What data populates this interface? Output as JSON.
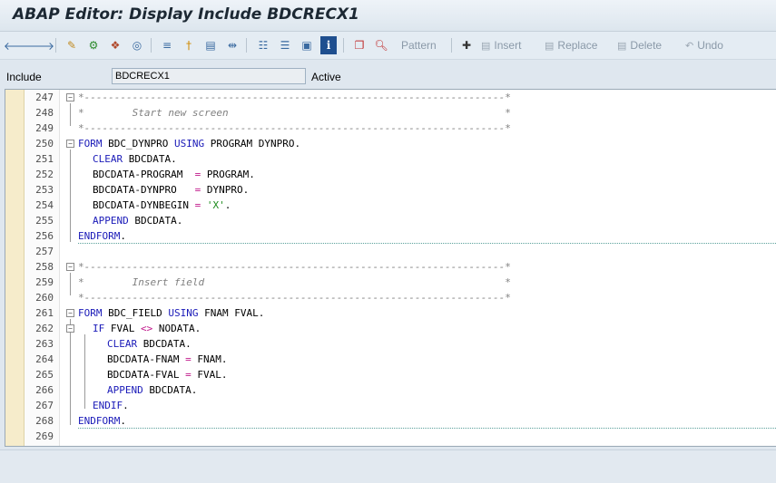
{
  "window": {
    "title": "ABAP Editor: Display Include BDCRECX1"
  },
  "toolbar": {
    "icons": [
      "back-icon",
      "forward-icon",
      "check-icon",
      "activate-icon",
      "test-icon",
      "where-used-icon",
      "display-object-list-icon",
      "breakpoint-icon",
      "navigation-window-icon",
      "pretty-printer-icon",
      "hierarchy-icon",
      "enhancement-icon",
      "screen-icon",
      "info-icon",
      "bookmark-icon",
      "search-icon"
    ],
    "pattern_label": "Pattern",
    "insert_label": "Insert",
    "replace_label": "Replace",
    "delete_label": "Delete",
    "undo_label": "Undo"
  },
  "include": {
    "label": "Include",
    "value": "BDCRECX1",
    "status": "Active"
  },
  "colors": {
    "keyword": "#1a1ab8",
    "string": "#1a8a1a",
    "operator": "#c0178b",
    "comment": "#808080",
    "gutter": "#f6eccb"
  },
  "code_lines": [
    {
      "n": "247"
    },
    {
      "n": "248"
    },
    {
      "n": "249"
    },
    {
      "n": "250"
    },
    {
      "n": "251"
    },
    {
      "n": "252"
    },
    {
      "n": "253"
    },
    {
      "n": "254"
    },
    {
      "n": "255"
    },
    {
      "n": "256"
    },
    {
      "n": "257"
    },
    {
      "n": "258"
    },
    {
      "n": "259"
    },
    {
      "n": "260"
    },
    {
      "n": "261"
    },
    {
      "n": "262"
    },
    {
      "n": "263"
    },
    {
      "n": "264"
    },
    {
      "n": "265"
    },
    {
      "n": "266"
    },
    {
      "n": "267"
    },
    {
      "n": "268"
    },
    {
      "n": "269"
    }
  ],
  "code": {
    "c247": "*----------------------------------------------------------------------*",
    "c248": "*        Start new screen                                              *",
    "c249": "*----------------------------------------------------------------------*",
    "c250_kw1": "FORM",
    "c250_a": " BDC_DYNPRO ",
    "c250_kw2": "USING",
    "c250_b": " PROGRAM DYNPRO.",
    "c251_kw": "CLEAR",
    "c251_a": " BDCDATA.",
    "c252_a": "BDCDATA-PROGRAM  ",
    "c252_op": "=",
    "c252_b": " PROGRAM.",
    "c253_a": "BDCDATA-DYNPRO   ",
    "c253_op": "=",
    "c253_b": " DYNPRO.",
    "c254_a": "BDCDATA-DYNBEGIN ",
    "c254_op": "=",
    "c254_str": " 'X'",
    "c254_b": ".",
    "c255_kw": "APPEND",
    "c255_a": " BDCDATA.",
    "c256_kw": "ENDFORM",
    "c256_a": ".",
    "c258": "*----------------------------------------------------------------------*",
    "c259": "*        Insert field                                                  *",
    "c260": "*----------------------------------------------------------------------*",
    "c261_kw1": "FORM",
    "c261_a": " BDC_FIELD ",
    "c261_kw2": "USING",
    "c261_b": " FNAM FVAL.",
    "c262_kw": "IF",
    "c262_a": " FVAL ",
    "c262_op": "<>",
    "c262_b": " NODATA.",
    "c263_kw": "CLEAR",
    "c263_a": " BDCDATA.",
    "c264_a": "BDCDATA-FNAM ",
    "c264_op": "=",
    "c264_b": " FNAM.",
    "c265_a": "BDCDATA-FVAL ",
    "c265_op": "=",
    "c265_b": " FVAL.",
    "c266_kw": "APPEND",
    "c266_a": " BDCDATA.",
    "c267_kw": "ENDIF",
    "c267_a": ".",
    "c268_kw": "ENDFORM",
    "c268_a": "."
  }
}
